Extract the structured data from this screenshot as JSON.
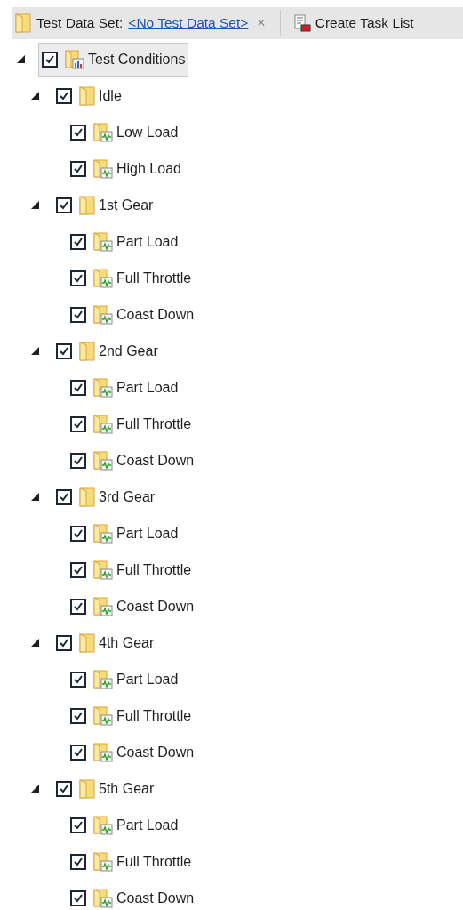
{
  "toolbar": {
    "data_set_label": "Test Data Set:",
    "data_set_link": "<No Test Data Set>",
    "clear_symbol": "×",
    "create_task_list": "Create Task List"
  },
  "tree": {
    "label": "Test Conditions",
    "kind": "root",
    "checked": true,
    "expanded": true,
    "selected": true,
    "children": [
      {
        "label": "Idle",
        "kind": "folder",
        "checked": true,
        "expanded": true,
        "selected": false,
        "children": [
          {
            "label": "Low Load",
            "kind": "condition",
            "checked": true,
            "selected": false
          },
          {
            "label": "High Load",
            "kind": "condition",
            "checked": true,
            "selected": false
          }
        ]
      },
      {
        "label": "1st Gear",
        "kind": "folder",
        "checked": true,
        "expanded": true,
        "selected": false,
        "children": [
          {
            "label": "Part Load",
            "kind": "condition",
            "checked": true,
            "selected": false
          },
          {
            "label": "Full Throttle",
            "kind": "condition",
            "checked": true,
            "selected": false
          },
          {
            "label": "Coast Down",
            "kind": "condition",
            "checked": true,
            "selected": false
          }
        ]
      },
      {
        "label": "2nd Gear",
        "kind": "folder",
        "checked": true,
        "expanded": true,
        "selected": false,
        "children": [
          {
            "label": "Part Load",
            "kind": "condition",
            "checked": true,
            "selected": false
          },
          {
            "label": "Full Throttle",
            "kind": "condition",
            "checked": true,
            "selected": false
          },
          {
            "label": "Coast Down",
            "kind": "condition",
            "checked": true,
            "selected": false
          }
        ]
      },
      {
        "label": "3rd Gear",
        "kind": "folder",
        "checked": true,
        "expanded": true,
        "selected": false,
        "children": [
          {
            "label": "Part Load",
            "kind": "condition",
            "checked": true,
            "selected": false
          },
          {
            "label": "Full Throttle",
            "kind": "condition",
            "checked": true,
            "selected": false
          },
          {
            "label": "Coast Down",
            "kind": "condition",
            "checked": true,
            "selected": false
          }
        ]
      },
      {
        "label": "4th Gear",
        "kind": "folder",
        "checked": true,
        "expanded": true,
        "selected": false,
        "children": [
          {
            "label": "Part Load",
            "kind": "condition",
            "checked": true,
            "selected": false
          },
          {
            "label": "Full Throttle",
            "kind": "condition",
            "checked": true,
            "selected": false
          },
          {
            "label": "Coast Down",
            "kind": "condition",
            "checked": true,
            "selected": false
          }
        ]
      },
      {
        "label": "5th Gear",
        "kind": "folder",
        "checked": true,
        "expanded": true,
        "selected": false,
        "children": [
          {
            "label": "Part Load",
            "kind": "condition",
            "checked": true,
            "selected": false
          },
          {
            "label": "Full Throttle",
            "kind": "condition",
            "checked": true,
            "selected": false
          },
          {
            "label": "Coast Down",
            "kind": "condition",
            "checked": true,
            "selected": false
          }
        ]
      }
    ]
  }
}
